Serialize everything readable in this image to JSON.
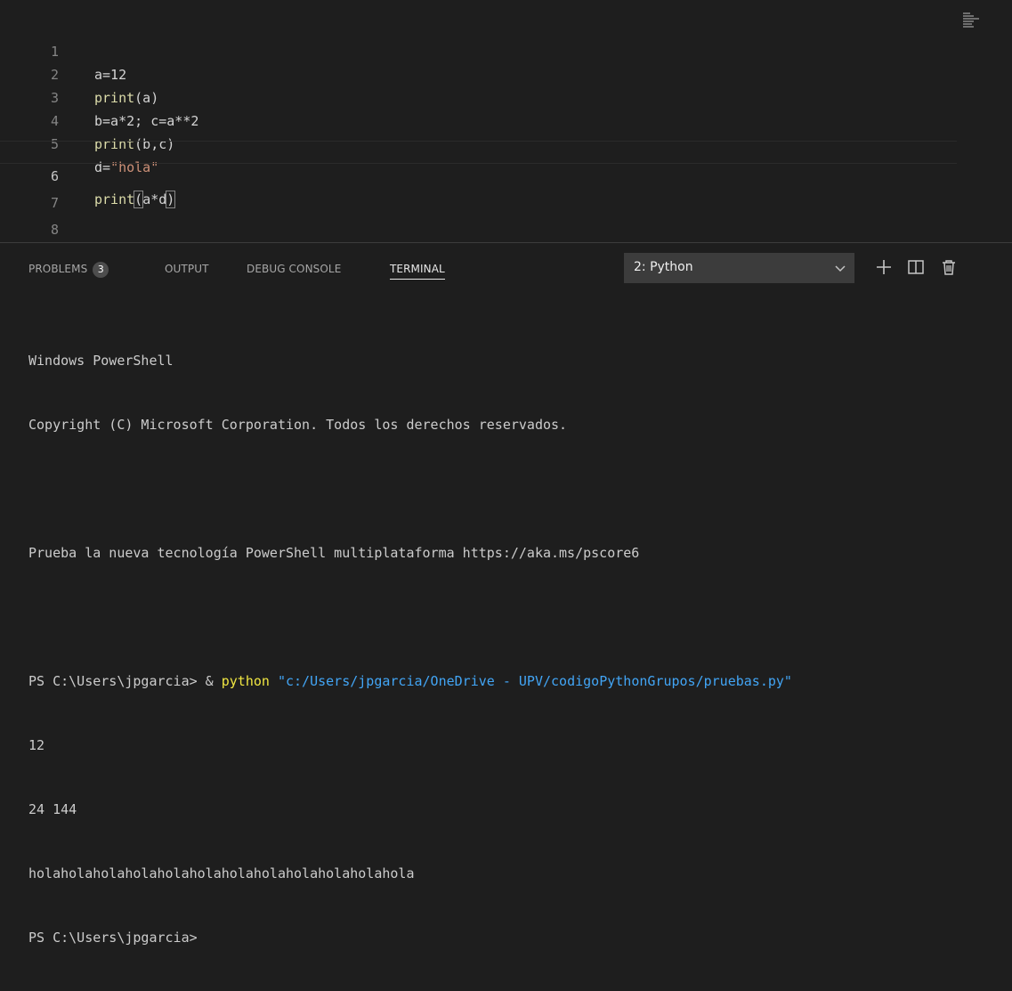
{
  "editor": {
    "lines": [
      {
        "num": "1",
        "text": "a=12"
      },
      {
        "num": "2",
        "pre": "",
        "fn": "print",
        "post": "(a)"
      },
      {
        "num": "3",
        "text": "b=a*2; c=a**2"
      },
      {
        "num": "4",
        "pre": "",
        "fn": "print",
        "post": "(b,c)"
      },
      {
        "num": "5",
        "pre": "d=",
        "str": "\"hola\""
      },
      {
        "num": "6",
        "fn": "print",
        "open": "(",
        "mid": "a*d",
        "close": ")"
      },
      {
        "num": "7",
        "text": ""
      },
      {
        "num": "8",
        "text": ""
      }
    ]
  },
  "panel": {
    "tabs": {
      "problems": "PROBLEMS",
      "problems_count": "3",
      "output": "OUTPUT",
      "debug_console": "DEBUG CONSOLE",
      "terminal": "TERMINAL"
    },
    "terminal_select": "2: Python",
    "icons": [
      "chevron-down-icon",
      "plus-icon",
      "split-terminal-icon",
      "trash-icon"
    ],
    "terminal_lines": {
      "l1": "Windows PowerShell",
      "l2": "Copyright (C) Microsoft Corporation. Todos los derechos reservados.",
      "l3": "Prueba la nueva tecnología PowerShell multiplataforma https://aka.ms/pscore6",
      "cmd_prompt": "PS C:\\Users\\jpgarcia> & ",
      "cmd_python": "python",
      "cmd_path": "\"c:/Users/jpgarcia/OneDrive - UPV/codigoPythonGrupos/pruebas.py\"",
      "out1": "12",
      "out2": "24 144",
      "out3": "holaholaholaholaholaholaholaholaholaholaholahola",
      "prompt_end": "PS C:\\Users\\jpgarcia>"
    }
  },
  "colors": {
    "background": "#1e1e1e",
    "function": "#dcdcaa",
    "string": "#ce9178",
    "terminal_python": "#f0e642",
    "terminal_string": "#42a5f5"
  }
}
